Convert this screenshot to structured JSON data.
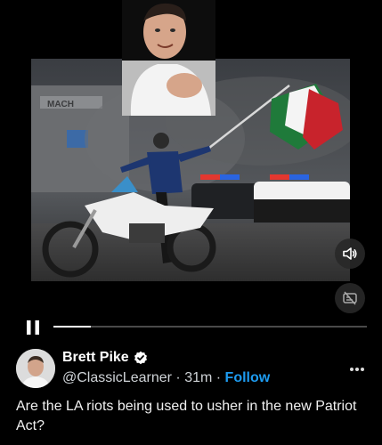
{
  "video": {
    "progress": 0.12,
    "sign_text": "MACH"
  },
  "author": {
    "name": "Brett Pike",
    "handle": "@ClassicLearner",
    "separator": "·",
    "time": "31m",
    "follow_label": "Follow",
    "verified": true
  },
  "post": {
    "text": "Are the LA riots being used to usher in the new Patriot Act?"
  },
  "colors": {
    "accent": "#1d9bf0",
    "background": "#000000"
  },
  "icons": {
    "pause": "pause-icon",
    "volume": "speaker-icon",
    "captions": "captions-off-icon",
    "verified": "verified-badge-icon",
    "more": "more-dots-icon"
  }
}
